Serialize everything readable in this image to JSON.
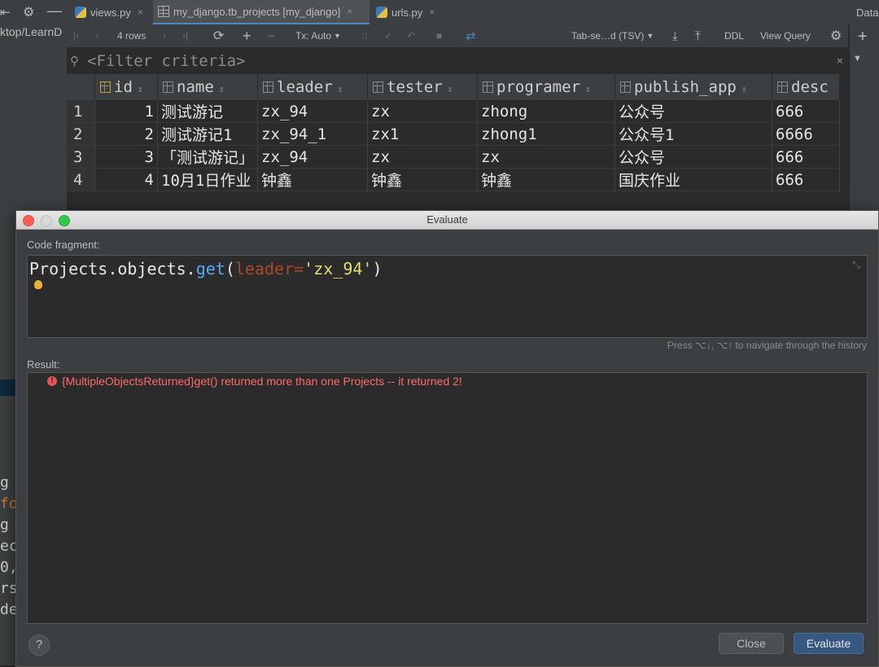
{
  "tabs": [
    {
      "label": "views.py",
      "close": "×"
    },
    {
      "label": "my_django.tb_projects [my_django]",
      "close": "×"
    },
    {
      "label": "urls.py",
      "close": "×"
    }
  ],
  "left_path": "ktop/LearnD",
  "right_panel_title": "Data",
  "toolbar": {
    "rows": "4 rows",
    "tx": "Tx: Auto",
    "format": "Tab-se…d (TSV)",
    "ddl": "DDL",
    "view_query": "View Query"
  },
  "filter": {
    "placeholder": "<Filter criteria>"
  },
  "table": {
    "columns": [
      "id",
      "name",
      "leader",
      "tester",
      "programer",
      "publish_app",
      "desc"
    ],
    "rows": [
      {
        "rn": "1",
        "id": "1",
        "name": "测试游记",
        "leader": "zx_94",
        "tester": "zx",
        "programer": "zhong",
        "publish_app": "公众号",
        "desc": "666"
      },
      {
        "rn": "2",
        "id": "2",
        "name": "测试游记1",
        "leader": "zx_94_1",
        "tester": "zx1",
        "programer": "zhong1",
        "publish_app": "公众号1",
        "desc": "6666"
      },
      {
        "rn": "3",
        "id": "3",
        "name": "「测试游记」",
        "leader": "zx_94",
        "tester": "zx",
        "programer": "zx",
        "publish_app": "公众号",
        "desc": "666"
      },
      {
        "rn": "4",
        "id": "4",
        "name": "10月1日作业",
        "leader": "钟鑫",
        "tester": "钟鑫",
        "programer": "钟鑫",
        "publish_app": "国庆作业",
        "desc": "666"
      }
    ]
  },
  "dialog": {
    "title": "Evaluate",
    "code_label": "Code fragment:",
    "code": {
      "obj": "Projects.objects.",
      "method": "get",
      "open": "(",
      "kw": "leader",
      "eq": "=",
      "str": "'zx_94'",
      "close": ")"
    },
    "history_hint": "Press ⌥↓, ⌥↑ to navigate through the history",
    "result_label": "Result:",
    "result_text": "{MultipleObjectsReturned}get() returned more than one Projects -- it returned 2!",
    "help": "?",
    "close_btn": "Close",
    "evaluate_btn": "Evaluate"
  },
  "background_code": [
    "g",
    "fo",
    "g",
    "",
    "ec",
    "0,",
    "rs",
    "de"
  ],
  "colors": {
    "accent": "#4a88c7",
    "error": "#ff6b68",
    "keyword_param": "#aa4926",
    "string": "#e6db74",
    "method": "#56a8f5"
  }
}
